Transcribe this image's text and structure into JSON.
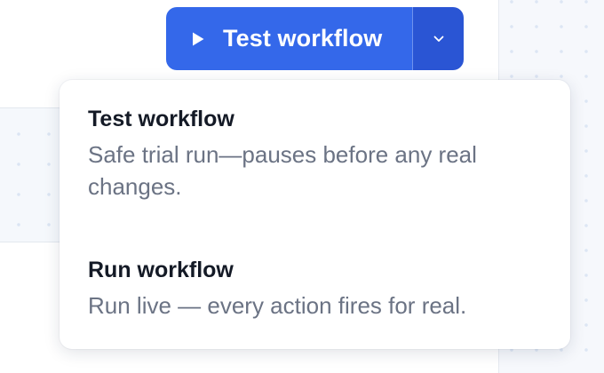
{
  "split_button": {
    "label": "Test workflow",
    "play_icon": "play-icon",
    "toggle_icon": "chevron-down-icon"
  },
  "menu": {
    "items": [
      {
        "title": "Test workflow",
        "description": "Safe trial run—pauses before any real changes."
      },
      {
        "title": "Run workflow",
        "description": "Run live — every action fires for real."
      }
    ]
  },
  "colors": {
    "primary": "#3468ea",
    "primary_dark": "#2a55d4",
    "text_dark": "#141a26",
    "text_muted": "#6b7384"
  }
}
